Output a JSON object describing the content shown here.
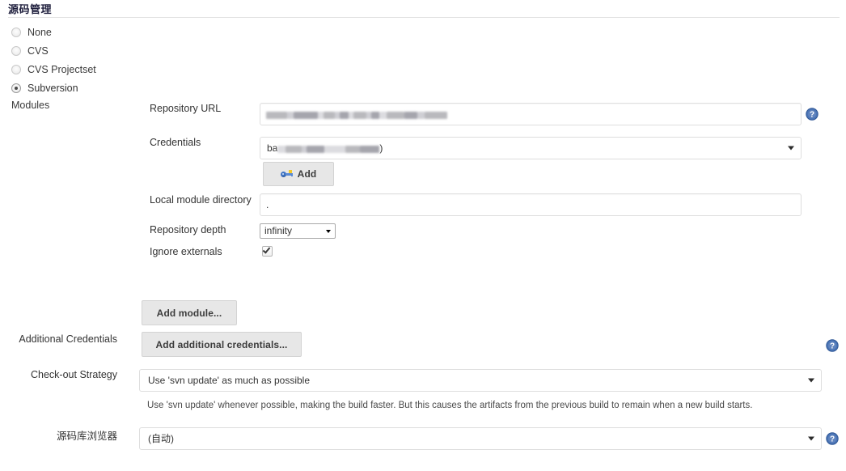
{
  "section": {
    "title": "源码管理"
  },
  "scm_options": [
    {
      "label": "None",
      "selected": false
    },
    {
      "label": "CVS",
      "selected": false
    },
    {
      "label": "CVS Projectset",
      "selected": false
    },
    {
      "label": "Subversion",
      "selected": true
    }
  ],
  "modules_label": "Modules",
  "fields": {
    "repository_url": {
      "label": "Repository URL",
      "value": "",
      "redacted": true
    },
    "credentials": {
      "label": "Credentials",
      "value_prefix": "ba",
      "value_suffix": ")",
      "redacted": true
    },
    "add_credentials_button": {
      "label": "Add",
      "icon": "key-icon"
    },
    "local_module_directory": {
      "label": "Local module directory",
      "value": "."
    },
    "repository_depth": {
      "label": "Repository depth",
      "value": "infinity"
    },
    "ignore_externals": {
      "label": "Ignore externals",
      "checked": true
    }
  },
  "add_module_button": {
    "label": "Add module..."
  },
  "additional_credentials": {
    "label": "Additional Credentials",
    "button_label": "Add additional credentials..."
  },
  "checkout_strategy": {
    "label": "Check-out Strategy",
    "value": "Use 'svn update' as much as possible",
    "hint": "Use 'svn update' whenever possible, making the build faster. But this causes the artifacts from the previous build to remain when a new build starts."
  },
  "repository_browser": {
    "label": "源码库浏览器",
    "value": "(自动)"
  },
  "help_icons": {
    "name": "help-icon",
    "color": "#3a64a8"
  }
}
